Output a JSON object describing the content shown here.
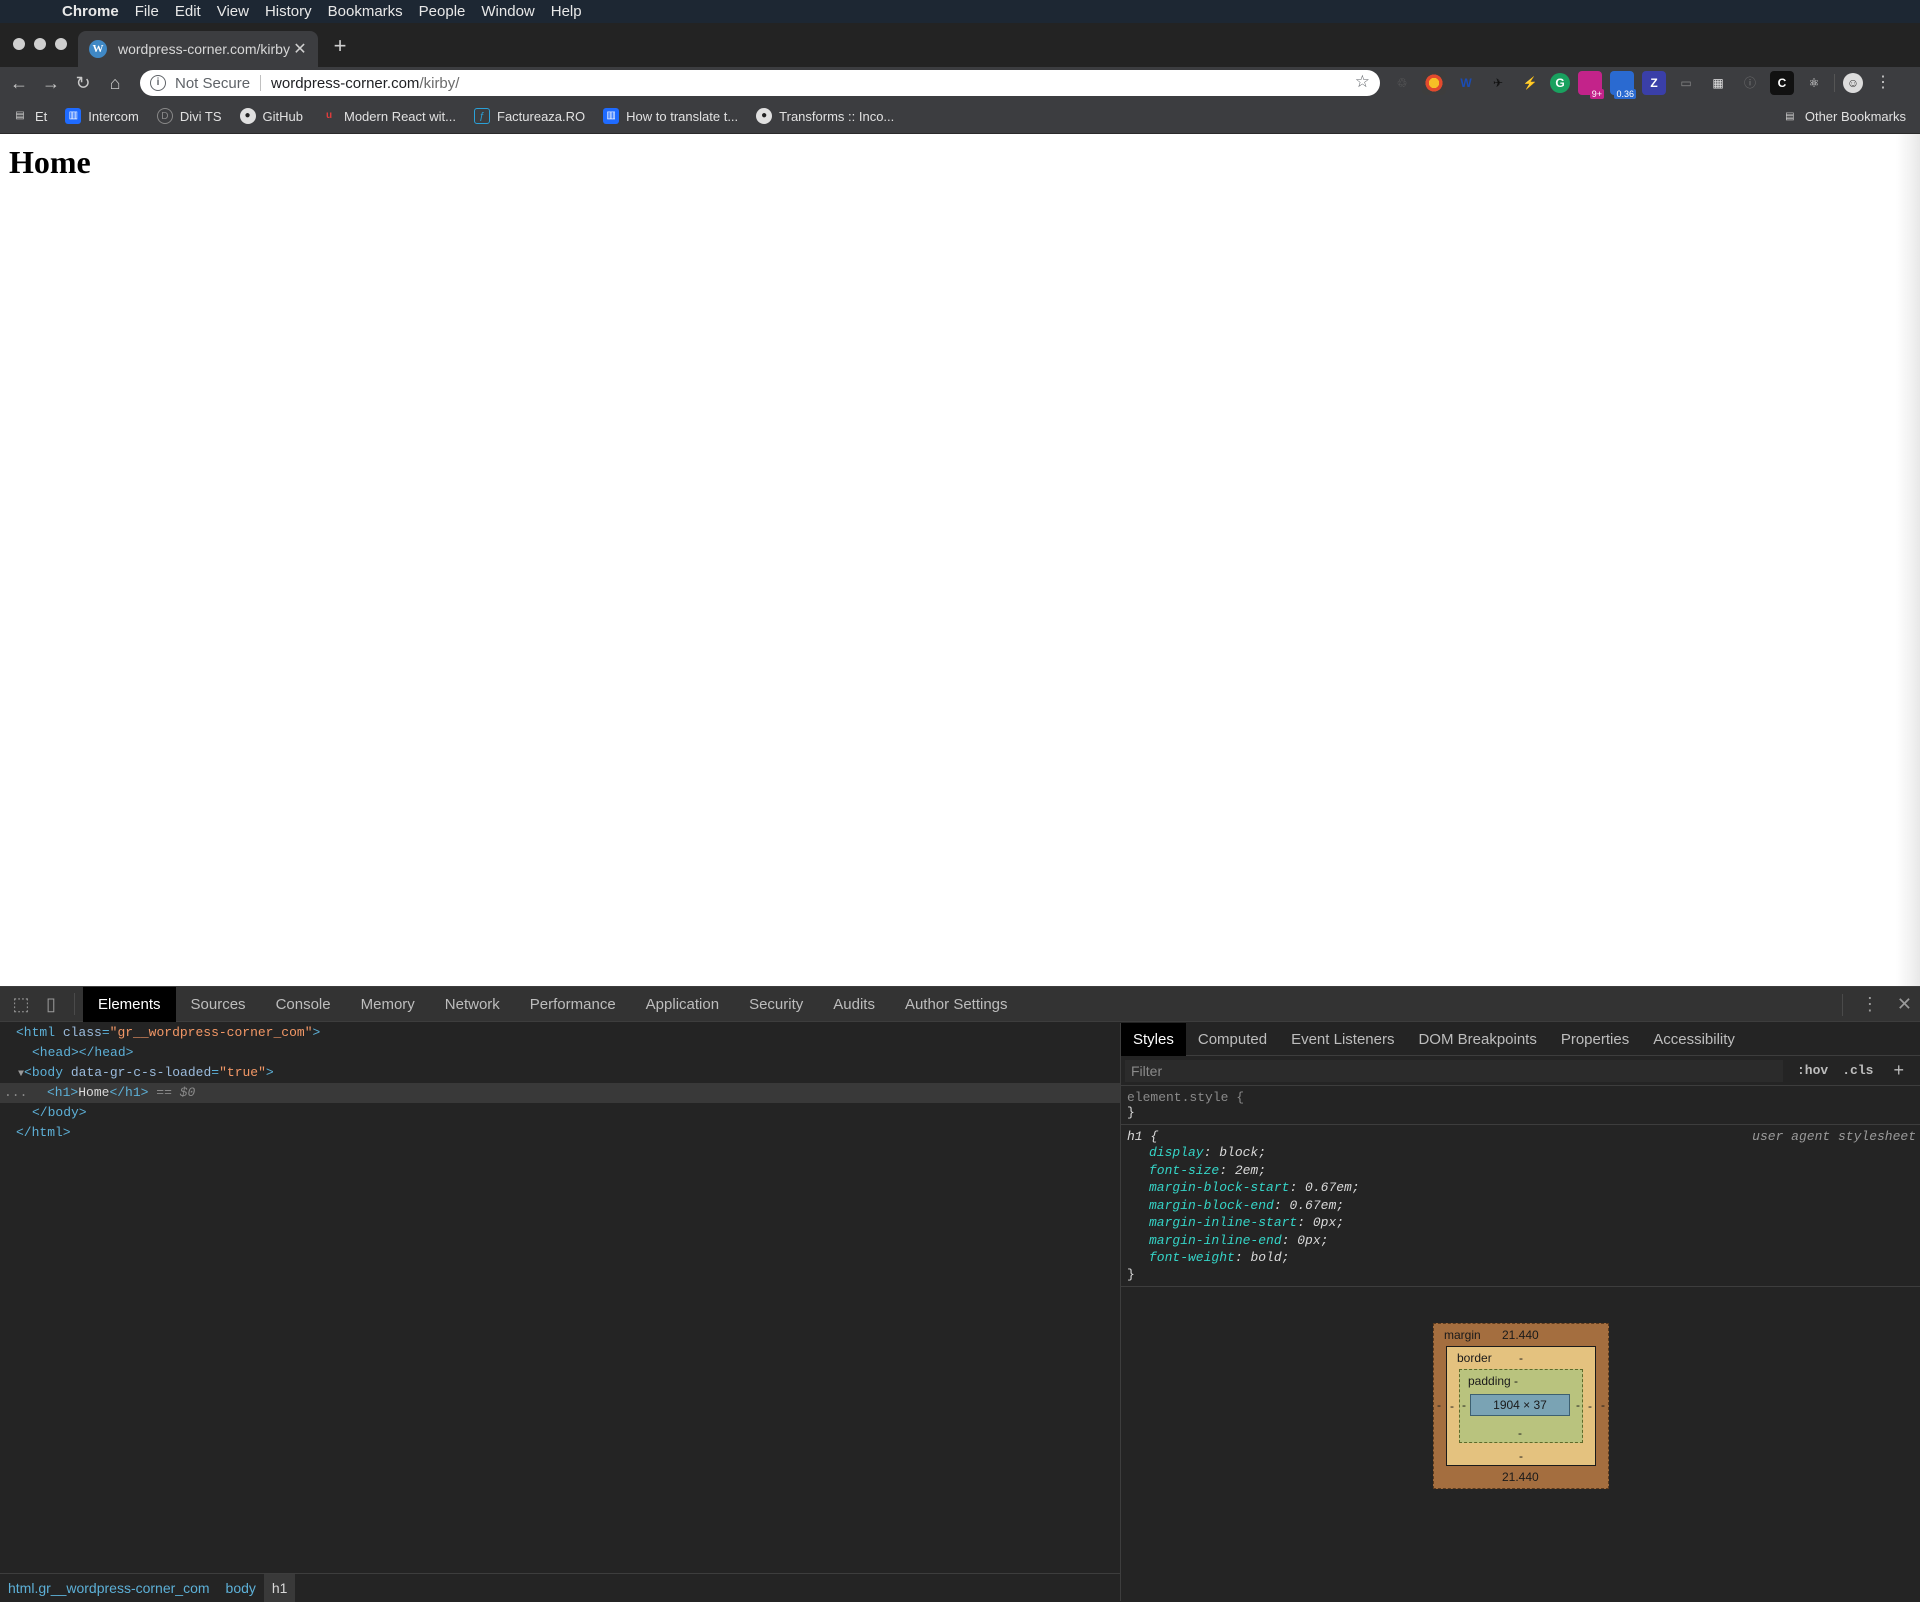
{
  "menubar": {
    "app": "Chrome",
    "items": [
      "File",
      "Edit",
      "View",
      "History",
      "Bookmarks",
      "People",
      "Window",
      "Help"
    ]
  },
  "tab": {
    "title": "wordpress-corner.com/kirby/",
    "favicon": "wordpress-icon"
  },
  "omnibox": {
    "security_label": "Not Secure",
    "host": "wordpress-corner.com",
    "path": "/kirby/"
  },
  "extensions": {
    "badges": [
      "9+",
      "0.36"
    ]
  },
  "bookmarks": {
    "items": [
      "Et",
      "Intercom",
      "Divi TS",
      "GitHub",
      "Modern React wit...",
      "Factureaza.RO",
      "How to translate t...",
      "Transforms :: Inco..."
    ],
    "other": "Other Bookmarks"
  },
  "page": {
    "heading": "Home"
  },
  "devtools": {
    "tabs": [
      "Elements",
      "Sources",
      "Console",
      "Memory",
      "Network",
      "Performance",
      "Application",
      "Security",
      "Audits",
      "Author Settings"
    ],
    "active_tab": "Elements",
    "dom": {
      "html_open_tag": "<html",
      "html_attr": "class",
      "html_val": "\"gr__wordpress-corner_com\"",
      "head": "<head></head>",
      "body_open_tag": "<body",
      "body_attr": "data-gr-c-s-loaded",
      "body_val": "\"true\"",
      "h1_open": "<h1>",
      "h1_text": "Home",
      "h1_close": "</h1>",
      "h1_marker": "== $0",
      "body_close": "</body>",
      "html_close": "</html>",
      "dots": "..."
    },
    "breadcrumbs": [
      "html.gr__wordpress-corner_com",
      "body",
      "h1"
    ],
    "sidebar_tabs": [
      "Styles",
      "Computed",
      "Event Listeners",
      "DOM Breakpoints",
      "Properties",
      "Accessibility"
    ],
    "filter_placeholder": "Filter",
    "filter_buttons": [
      ":hov",
      ".cls",
      "+"
    ],
    "element_style": {
      "selector": "element.style {",
      "close": "}"
    },
    "h1_rule": {
      "selector": "h1 {",
      "source": "user agent stylesheet",
      "declarations": [
        {
          "prop": "display",
          "value": "block;"
        },
        {
          "prop": "font-size",
          "value": "2em;"
        },
        {
          "prop": "margin-block-start",
          "value": "0.67em;"
        },
        {
          "prop": "margin-block-end",
          "value": "0.67em;"
        },
        {
          "prop": "margin-inline-start",
          "value": "0px;"
        },
        {
          "prop": "margin-inline-end",
          "value": "0px;"
        },
        {
          "prop": "font-weight",
          "value": "bold;"
        }
      ],
      "close": "}"
    },
    "box_model": {
      "margin_label": "margin",
      "margin_top": "21.440",
      "margin_bottom": "21.440",
      "border_label": "border",
      "padding_label": "padding -",
      "dash": "-",
      "content": "1904 × 37"
    }
  }
}
